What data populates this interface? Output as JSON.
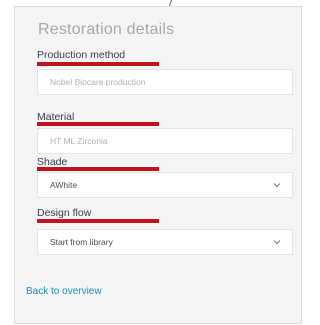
{
  "panel": {
    "title": "Restoration details"
  },
  "fields": [
    {
      "label": "Production method",
      "value": "Nobel Biocare production",
      "type": "readonly"
    },
    {
      "label": "Material",
      "value": "HT ML Zirconia",
      "type": "readonly"
    },
    {
      "label": "Shade",
      "value": "AWhite",
      "type": "select"
    },
    {
      "label": "Design flow",
      "value": "Start from library",
      "type": "select"
    }
  ],
  "links": {
    "back": "Back to overview"
  },
  "colors": {
    "underline": "#c0141d",
    "link": "#1a8fb8",
    "title": "#a4a8ad",
    "panel_bg": "#f4f5f6"
  },
  "icons": {
    "select_chevron": "chevron-down-icon"
  }
}
